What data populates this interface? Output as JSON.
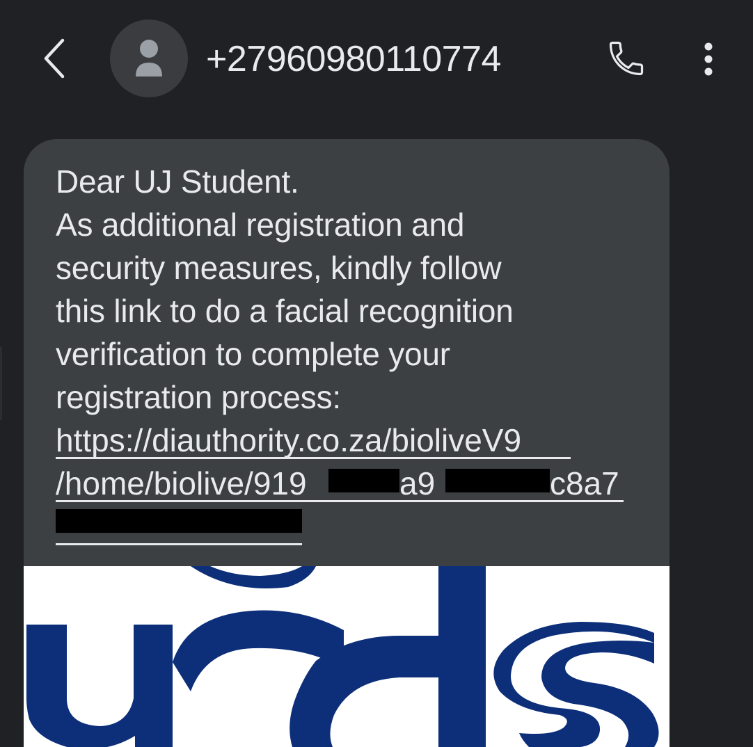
{
  "header": {
    "contact_number": "+27960980110774",
    "icons": {
      "back": "chevron-left-icon",
      "avatar": "person-icon",
      "call": "phone-icon",
      "menu": "more-vert-icon"
    }
  },
  "message": {
    "lines": [
      "Dear UJ Student.",
      "As additional registration and",
      "security measures, kindly follow",
      "this link to do a facial recognition",
      "verification to complete your",
      "registration process:"
    ],
    "link_line_1": "https://diauthority.co.za/bioliveV9",
    "link_line_2": "/home/biolive/919",
    "link_line_2_mid": "a9",
    "link_line_2_end": "c8a7"
  },
  "colors": {
    "background": "#1f2124",
    "bubble": "#3c4043",
    "text": "#e8eaed",
    "logo_blue": "#0d2f7a"
  }
}
